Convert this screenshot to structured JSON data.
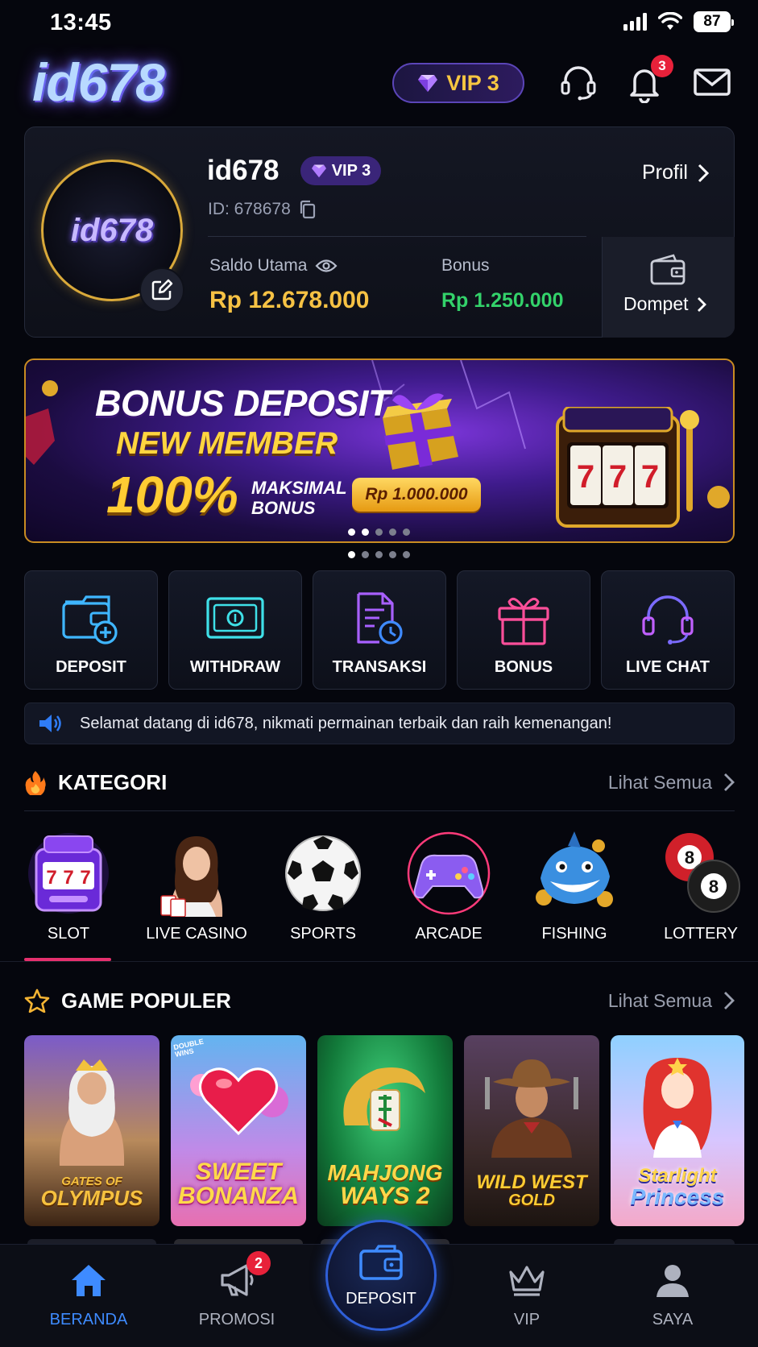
{
  "status_bar": {
    "time": "13:45",
    "battery": "87"
  },
  "header": {
    "logo": "id678",
    "vip_label": "VIP 3",
    "notification_count": "3"
  },
  "profile": {
    "avatar_logo": "id678",
    "username": "id678",
    "vip_tag": "VIP 3",
    "user_id": "ID: 678678",
    "profile_link": "Profil",
    "main_balance_label": "Saldo Utama",
    "main_balance": "Rp 12.678.000",
    "bonus_label": "Bonus",
    "bonus_balance": "Rp 1.250.000",
    "wallet_label": "Dompet"
  },
  "banner": {
    "line1": "BONUS DEPOSIT",
    "line2": "NEW MEMBER",
    "percent": "100%",
    "max_label": "MAKSIMAL BONUS",
    "max_amount": "Rp 1.000.000",
    "reel": "7"
  },
  "quick_actions": [
    {
      "label": "DEPOSIT",
      "icon": "wallet-plus-icon",
      "color": "#3fb6ff"
    },
    {
      "label": "WITHDRAW",
      "icon": "cash-icon",
      "color": "#3fe0e8"
    },
    {
      "label": "TRANSAKSI",
      "icon": "document-clock-icon",
      "color": "#a860ff"
    },
    {
      "label": "BONUS",
      "icon": "gift-icon",
      "color": "#ff4f9a"
    },
    {
      "label": "LIVE CHAT",
      "icon": "headset-icon",
      "color": "#7b6bff"
    }
  ],
  "marquee": {
    "text": "Selamat datang di id678, nikmati permainan terbaik dan raih kemenangan!"
  },
  "categories_section": {
    "title": "KATEGORI",
    "see_all": "Lihat Semua",
    "items": [
      {
        "label": "SLOT",
        "active": true
      },
      {
        "label": "LIVE CASINO"
      },
      {
        "label": "SPORTS"
      },
      {
        "label": "ARCADE"
      },
      {
        "label": "FISHING"
      },
      {
        "label": "LOTTERY"
      }
    ],
    "lottery_ball": "8"
  },
  "popular_section": {
    "title": "GAME POPULER",
    "see_all": "Lihat Semua",
    "games": [
      {
        "line1": "GATES OF",
        "line2": "OLYMPUS"
      },
      {
        "line1": "SWEET",
        "line2": "BONANZA",
        "corner": "DOUBLE WINS"
      },
      {
        "line1": "MAHJONG",
        "line2": "WAYS 2"
      },
      {
        "line1": "WILD WEST",
        "line2": "GOLD"
      },
      {
        "line1": "Starlight",
        "line2": "Princess"
      }
    ]
  },
  "bottom_nav": {
    "items": [
      {
        "label": "BERANDA",
        "active": true
      },
      {
        "label": "PROMOSI",
        "badge": "2"
      },
      {
        "label": "DEPOSIT"
      },
      {
        "label": "VIP"
      },
      {
        "label": "SAYA"
      }
    ]
  },
  "colors": {
    "gold": "#f6c244",
    "green": "#33d26a",
    "accent_blue": "#3e8bff",
    "accent_pink": "#e6306e"
  }
}
